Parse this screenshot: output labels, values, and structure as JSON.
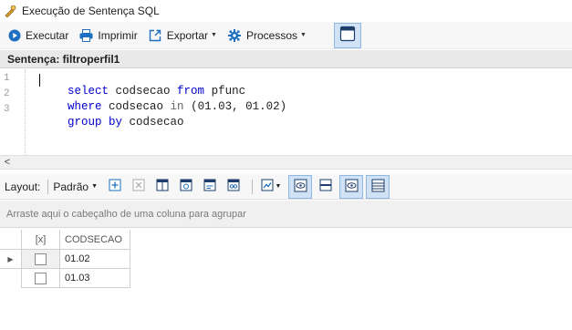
{
  "window": {
    "title": "Execução de Sentença SQL",
    "title_icon": "sql-execute-icon"
  },
  "toolbar": {
    "execute_label": "Executar",
    "print_label": "Imprimir",
    "export_label": "Exportar",
    "processes_label": "Processos",
    "accent": "#1e6fbf"
  },
  "sentence": {
    "header": "Sentença: filtroperfil1"
  },
  "editor": {
    "lines": [
      {
        "number": "1",
        "parts": [
          {
            "t": "select",
            "k": "kw"
          },
          {
            "t": " codsecao ",
            "k": ""
          },
          {
            "t": "from",
            "k": "kw"
          },
          {
            "t": " pfunc",
            "k": ""
          }
        ]
      },
      {
        "number": "2",
        "parts": [
          {
            "t": "where",
            "k": "kw"
          },
          {
            "t": " codsecao ",
            "k": ""
          },
          {
            "t": "in",
            "k": "cm"
          },
          {
            "t": " (01.03, 01.02)",
            "k": ""
          }
        ]
      },
      {
        "number": "3",
        "parts": [
          {
            "t": "group by",
            "k": "kw"
          },
          {
            "t": " codsecao",
            "k": ""
          }
        ]
      }
    ],
    "keyword_color": "#0000d0"
  },
  "layout_bar": {
    "label": "Layout:",
    "layout_value": "Padrão"
  },
  "group_area": {
    "placeholder": "Arraste aqui o cabeçalho de uma coluna para agrupar"
  },
  "grid": {
    "select_header": "[x]",
    "columns": [
      "CODSECAO"
    ],
    "rows": [
      {
        "codsecao": "01.02"
      },
      {
        "codsecao": "01.03"
      }
    ]
  }
}
